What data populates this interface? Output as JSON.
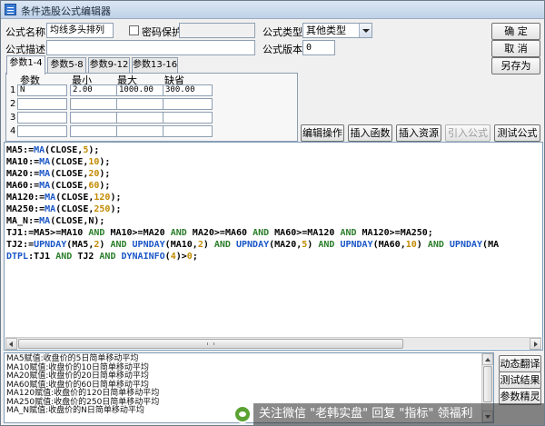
{
  "window": {
    "title": "条件选股公式编辑器"
  },
  "form": {
    "name_label": "公式名称",
    "name_value": "均线多头排列",
    "password_label": "密码保护",
    "password_checked": false,
    "password_value": "",
    "type_label": "公式类型",
    "type_value": "其他类型",
    "desc_label": "公式描述",
    "desc_value": "",
    "version_label": "公式版本",
    "version_value": "0"
  },
  "buttons": {
    "ok": "确  定",
    "cancel": "取  消",
    "save_as": "另存为",
    "edit_ops": "编辑操作",
    "insert_func": "插入函数",
    "insert_resource": "插入资源",
    "import_formula": "引入公式",
    "test_formula": "测试公式",
    "dynamic_translate": "动态翻译",
    "test_result": "测试结果",
    "param_wizard": "参数精灵"
  },
  "tabs": [
    "参数1-4",
    "参数5-8",
    "参数9-12",
    "参数13-16"
  ],
  "active_tab": 0,
  "params": {
    "headers": [
      "参数",
      "最小",
      "最大",
      "缺省"
    ],
    "rows": [
      {
        "num": "1",
        "name": "N",
        "min": "2.00",
        "max": "1000.00",
        "default": "300.00"
      },
      {
        "num": "2",
        "name": "",
        "min": "",
        "max": "",
        "default": ""
      },
      {
        "num": "3",
        "name": "",
        "min": "",
        "max": "",
        "default": ""
      },
      {
        "num": "4",
        "name": "",
        "min": "",
        "max": "",
        "default": ""
      }
    ]
  },
  "code_lines": [
    "MA5:=MA(CLOSE,5);",
    "MA10:=MA(CLOSE,10);",
    "MA20:=MA(CLOSE,20);",
    "MA60:=MA(CLOSE,60);",
    "MA120:=MA(CLOSE,120);",
    "MA250:=MA(CLOSE,250);",
    "MA_N:=MA(CLOSE,N);",
    "TJ1:=MA5>=MA10 AND MA10>=MA20 AND MA20>=MA60 AND MA60>=MA120 AND MA120>=MA250;",
    "TJ2:=UPNDAY(MA5,2) AND UPNDAY(MA10,2) AND UPNDAY(MA20,5) AND UPNDAY(MA60,10) AND UPNDAY(MA",
    "DTPL:TJ1 AND TJ2 AND DYNAINFO(4)>0;"
  ],
  "desc_lines": [
    "MA5赋值:收盘价的5日简单移动平均",
    "MA10赋值:收盘价的10日简单移动平均",
    "MA20赋值:收盘价的20日简单移动平均",
    "MA60赋值:收盘价的60日简单移动平均",
    "MA120赋值:收盘价的120日简单移动平均",
    "MA250赋值:收盘价的250日简单移动平均",
    "MA_N赋值:收盘价的N日简单移动平均"
  ],
  "watermark": "关注微信 \"老韩实盘\" 回复 \"指标\" 领福利",
  "colors": {
    "function": "#1a56c7",
    "keyword": "#2a7d2a",
    "number": "#c28a00",
    "variable": "#006c8c"
  }
}
